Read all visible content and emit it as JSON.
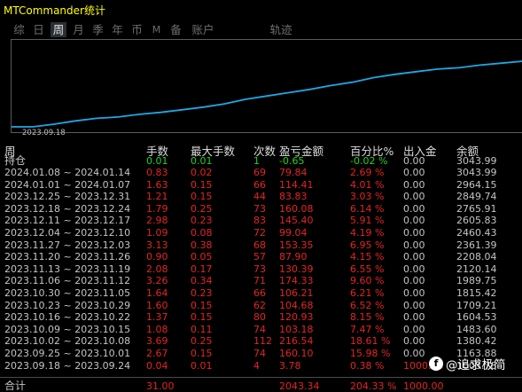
{
  "app": {
    "title": "MTCommander统计"
  },
  "tabs": [
    {
      "label": "综"
    },
    {
      "label": "日"
    },
    {
      "label": "周"
    },
    {
      "label": "月"
    },
    {
      "label": "季"
    },
    {
      "label": "年"
    },
    {
      "label": "币"
    },
    {
      "label": "M"
    },
    {
      "label": "备"
    },
    {
      "label": "账户"
    },
    {
      "label": "轨迹"
    }
  ],
  "active_tab": "周",
  "chart": {
    "date_label": "2023.09.18",
    "line_color": "#1fa7e6",
    "series_values": [
      0.0,
      0.0,
      0.04,
      0.09,
      0.13,
      0.15,
      0.19,
      0.22,
      0.26,
      0.3,
      0.35,
      0.42,
      0.47,
      0.52,
      0.57,
      0.63,
      0.68,
      0.75,
      0.8,
      0.84,
      0.88,
      0.9,
      0.94,
      0.97,
      1.0
    ]
  },
  "table": {
    "headers": [
      "周",
      "手数",
      "最大手数",
      "次数",
      "盈亏金额",
      "百分比%",
      "出入金",
      "余额"
    ],
    "holding": [
      "持仓",
      "0.01",
      "0.01",
      "1",
      "-0.65",
      "-0.02 %",
      "0.00",
      "3043.99"
    ],
    "rows": [
      [
        "2024.01.08 ~ 2024.01.14",
        "0.83",
        "0.02",
        "69",
        "79.84",
        "2.69 %",
        "0.00",
        "3043.99"
      ],
      [
        "2024.01.01 ~ 2024.01.07",
        "1.63",
        "0.15",
        "66",
        "114.41",
        "4.01 %",
        "0.00",
        "2964.15"
      ],
      [
        "2023.12.25 ~ 2023.12.31",
        "1.21",
        "0.15",
        "44",
        "83.83",
        "3.03 %",
        "0.00",
        "2849.74"
      ],
      [
        "2023.12.18 ~ 2023.12.24",
        "1.79",
        "0.25",
        "73",
        "160.08",
        "6.14 %",
        "0.00",
        "2765.91"
      ],
      [
        "2023.12.11 ~ 2023.12.17",
        "2.98",
        "0.23",
        "83",
        "145.40",
        "5.91 %",
        "0.00",
        "2605.83"
      ],
      [
        "2023.12.04 ~ 2023.12.10",
        "1.09",
        "0.08",
        "72",
        "99.04",
        "4.19 %",
        "0.00",
        "2460.43"
      ],
      [
        "2023.11.27 ~ 2023.12.03",
        "3.13",
        "0.38",
        "68",
        "153.35",
        "6.95 %",
        "0.00",
        "2361.39"
      ],
      [
        "2023.11.20 ~ 2023.11.26",
        "0.90",
        "0.05",
        "57",
        "87.90",
        "4.15 %",
        "0.00",
        "2208.04"
      ],
      [
        "2023.11.13 ~ 2023.11.19",
        "2.08",
        "0.17",
        "73",
        "130.39",
        "6.55 %",
        "0.00",
        "2120.14"
      ],
      [
        "2023.11.06 ~ 2023.11.12",
        "3.26",
        "0.34",
        "71",
        "174.33",
        "9.60 %",
        "0.00",
        "1989.75"
      ],
      [
        "2023.10.30 ~ 2023.11.05",
        "1.64",
        "0.23",
        "66",
        "106.21",
        "6.21 %",
        "0.00",
        "1815.42"
      ],
      [
        "2023.10.23 ~ 2023.10.29",
        "1.60",
        "0.15",
        "62",
        "104.68",
        "6.52 %",
        "0.00",
        "1709.21"
      ],
      [
        "2023.10.16 ~ 2023.10.22",
        "1.37",
        "0.15",
        "80",
        "120.93",
        "8.15 %",
        "0.00",
        "1604.53"
      ],
      [
        "2023.10.09 ~ 2023.10.15",
        "1.08",
        "0.11",
        "74",
        "103.18",
        "7.47 %",
        "0.00",
        "1483.60"
      ],
      [
        "2023.10.02 ~ 2023.10.08",
        "3.69",
        "0.25",
        "112",
        "216.54",
        "18.61 %",
        "0.00",
        "1380.42"
      ],
      [
        "2023.09.25 ~ 2023.10.01",
        "2.67",
        "0.15",
        "74",
        "160.10",
        "15.98 %",
        "0.00",
        "1163.88"
      ],
      [
        "2023.09.18 ~ 2023.09.24",
        "0.04",
        "0.01",
        "4",
        "3.78",
        "0.38 %",
        "1000.00",
        "1003.78"
      ]
    ],
    "total": [
      "合计",
      "31.00",
      "",
      "",
      "2043.34",
      "204.33 %",
      "1000.00",
      ""
    ]
  },
  "watermark": {
    "text": "@追求极简"
  }
}
